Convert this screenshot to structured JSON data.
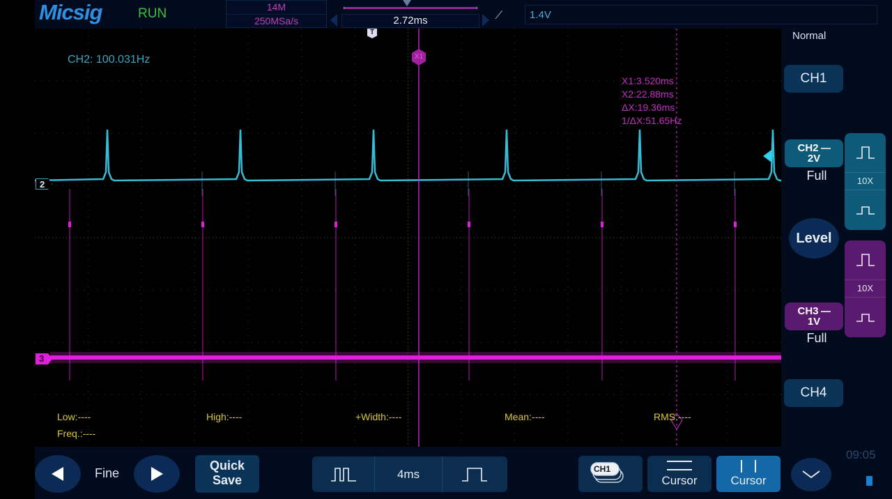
{
  "header": {
    "brand": "Micsig",
    "run_state": "RUN",
    "memory_depth": "14M",
    "sample_rate": "250MSa/s",
    "horizontal_position": "2.72ms",
    "trigger_edge_icon": "rising-edge-icon",
    "trigger_level": "␶1.4V"
  },
  "plot": {
    "ch2_frequency": "CH2: 100.031Hz",
    "trigger_marker": "T",
    "cursor_marker_x1": "X1",
    "cursor_readout": {
      "x1": "X1:3.520ms",
      "x2": "X2:22.88ms",
      "dx": "ΔX:19.36ms",
      "inv_dx": "1/ΔX:51.65Hz"
    },
    "channel_markers": {
      "ch2": "2",
      "ch3": "3"
    },
    "measurements": {
      "low": "Low:----",
      "high": "High:----",
      "width": "+Width:----",
      "mean": "Mean:----",
      "rms": "RMS:----",
      "freq": "Freq.:----"
    }
  },
  "right_panel": {
    "trigger_mode": "Normal",
    "ch1_label": "CH1",
    "ch2": {
      "name": "CH2",
      "scale": "2V",
      "bandwidth": "Full",
      "probe": "10X",
      "color": "#0e5a78"
    },
    "level_label": "Level",
    "ch3": {
      "name": "CH3",
      "scale": "1V",
      "bandwidth": "Full",
      "probe": "10X",
      "color": "#5a1a70"
    },
    "ch4_label": "CH4"
  },
  "bottom_bar": {
    "fine_label": "Fine",
    "quick_save_line1": "Quick",
    "quick_save_line2": "Save",
    "timebase": "4ms",
    "ch1_badge": "CH1",
    "h_cursor_label": "Cursor",
    "v_cursor_label": "Cursor",
    "clock": "09:05"
  },
  "colors": {
    "ch2": "#3ac8e0",
    "ch3": "#e020d8",
    "cursor": "#c030c0",
    "measure_text": "#d8c83a",
    "run": "#36c23a",
    "brand": "#2f8fe0"
  }
}
